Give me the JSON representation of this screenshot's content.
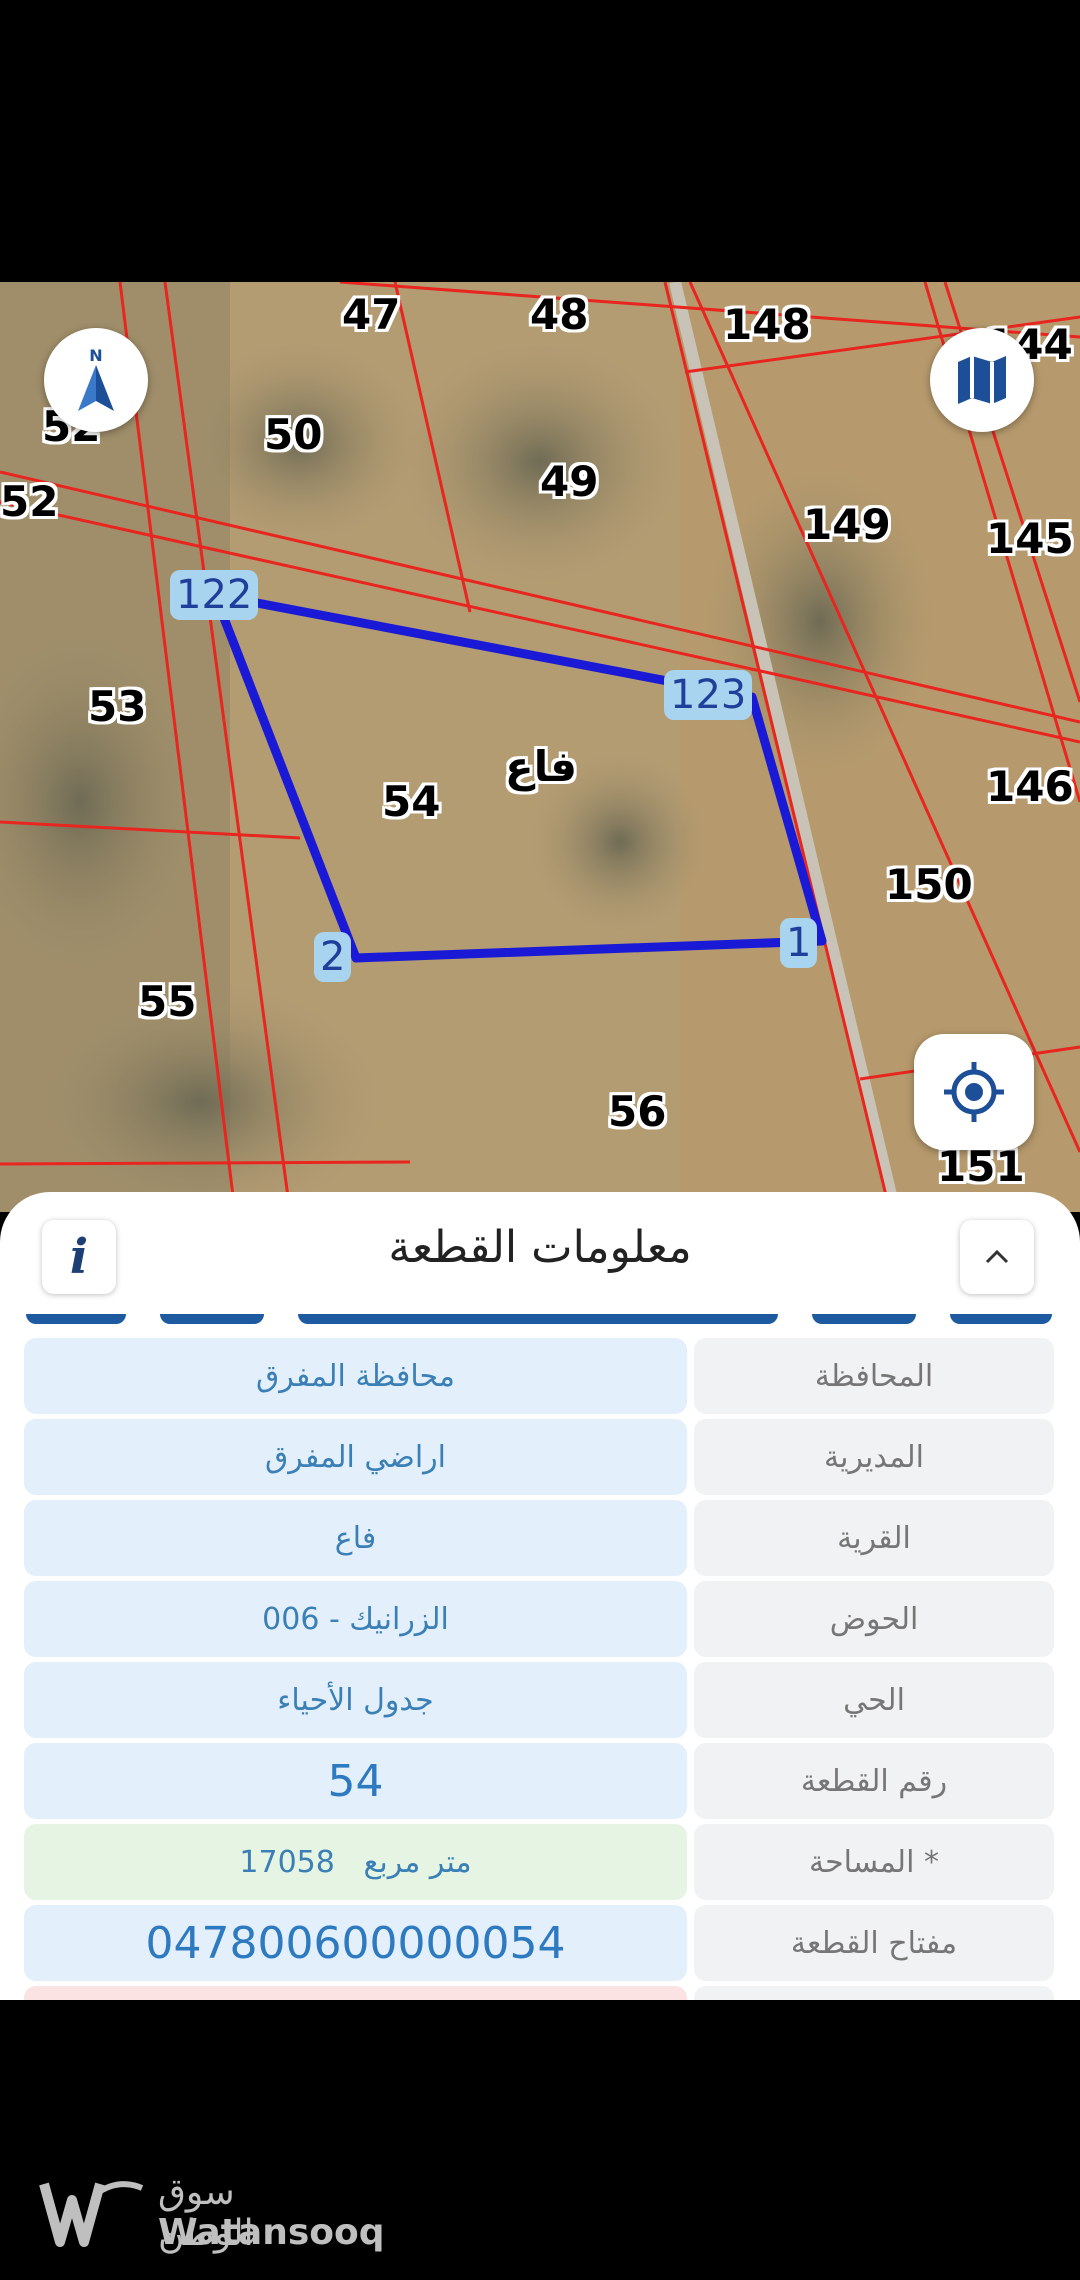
{
  "map": {
    "plot_numbers": [
      "47",
      "48",
      "148",
      "144",
      "52",
      "50",
      "49",
      "149",
      "145",
      "52",
      "122",
      "53",
      "123",
      "146",
      "54",
      "150",
      "55",
      "56",
      "151"
    ],
    "village_label": "فاع",
    "vertices": [
      "122",
      "123",
      "2",
      "1"
    ]
  },
  "sheet": {
    "title": "معلومات القطعة",
    "rows": [
      {
        "label": "المحافظة",
        "value": "محافظة المفرق"
      },
      {
        "label": "المديرية",
        "value": "اراضي المفرق"
      },
      {
        "label": "القرية",
        "value": "فاع"
      },
      {
        "label": "الحوض",
        "value": "الزرانيك - 006"
      },
      {
        "label": "الحي",
        "value": "جدول الأحياء"
      },
      {
        "label": "رقم القطعة",
        "value": "54"
      },
      {
        "label": "المساحة *",
        "value": "17058   متر مربع"
      },
      {
        "label": "مفتاح القطعة",
        "value": "047800600000054"
      }
    ]
  },
  "watermark": {
    "arabic": "سوق الوطن",
    "english": "Watansooq"
  },
  "icons": {
    "compass": "north-compass-icon",
    "layers": "map-layers-icon",
    "locate": "my-location-icon",
    "info": "info-icon",
    "collapse": "chevron-up-icon"
  },
  "colors": {
    "boundary": "#1a1ad6",
    "parcel_lines": "#e8251f",
    "value_text": "#3a7fb5"
  }
}
